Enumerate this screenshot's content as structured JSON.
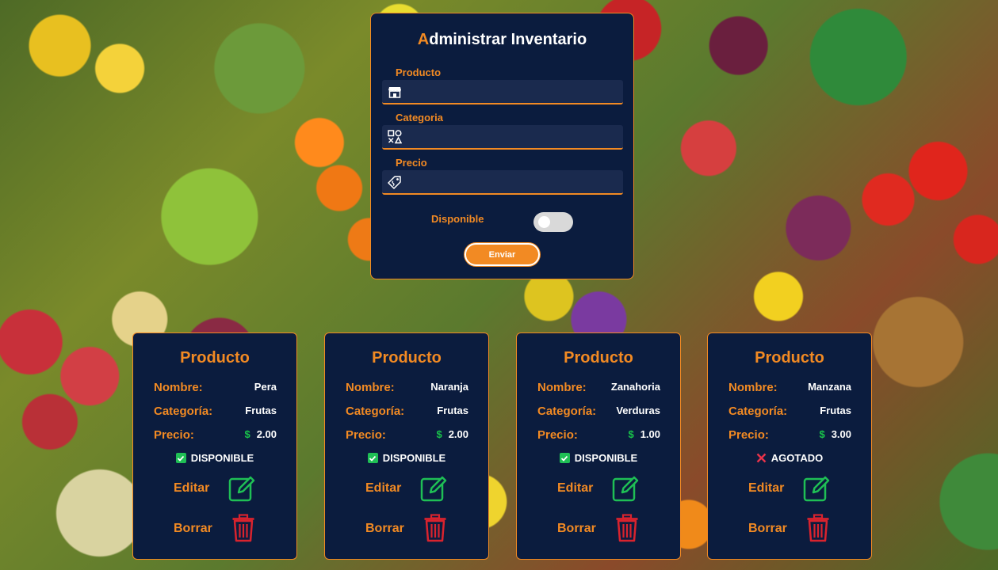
{
  "form": {
    "title_first": "A",
    "title_rest": "dministrar Inventario",
    "fields": [
      {
        "label": "Producto",
        "icon": "store-icon",
        "value": ""
      },
      {
        "label": "Categoria",
        "icon": "category-shapes-icon",
        "value": ""
      },
      {
        "label": "Precio",
        "icon": "price-tag-icon",
        "value": ""
      }
    ],
    "toggle_label": "Disponible",
    "toggle_on": false,
    "submit_label": "Enviar"
  },
  "labels": {
    "card_title": "Producto",
    "nombre": "Nombre:",
    "categoria": "Categoría:",
    "precio": "Precio:",
    "currency": "$",
    "edit": "Editar",
    "delete": "Borrar"
  },
  "products": [
    {
      "nombre": "Pera",
      "categoria": "Frutas",
      "precio": "2.00",
      "status": "DISPONIBLE",
      "available": true
    },
    {
      "nombre": "Naranja",
      "categoria": "Frutas",
      "precio": "2.00",
      "status": "DISPONIBLE",
      "available": true
    },
    {
      "nombre": "Zanahoria",
      "categoria": "Verduras",
      "precio": "1.00",
      "status": "DISPONIBLE",
      "available": true
    },
    {
      "nombre": "Manzana",
      "categoria": "Frutas",
      "precio": "3.00",
      "status": "AGOTADO",
      "available": false
    }
  ],
  "colors": {
    "accent": "#f28a23",
    "card_bg": "#0b1c3e",
    "available": "#1fbf55",
    "unavailable": "#e8334a",
    "edit_icon": "#1fbf55",
    "delete_icon": "#d9232e"
  }
}
